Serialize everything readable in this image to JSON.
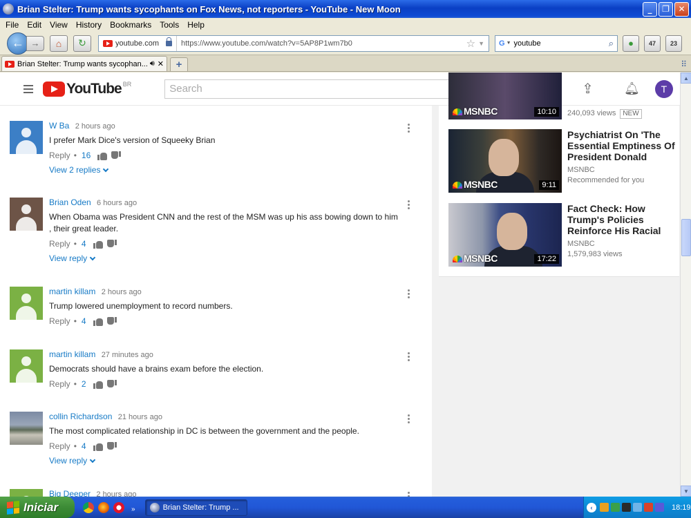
{
  "window": {
    "title": "Brian Stelter: Trump wants sycophants on Fox News, not reporters - YouTube - New Moon",
    "minimize": "_",
    "maximize": "❐",
    "close": "✕"
  },
  "menu": [
    "File",
    "Edit",
    "View",
    "History",
    "Bookmarks",
    "Tools",
    "Help"
  ],
  "nav": {
    "site_label": "youtube.com",
    "url": "https://www.youtube.com/watch?v=5AP8P1wm7b0",
    "search_engine": "G",
    "search_query": "youtube",
    "ext_badges": [
      "47",
      "23"
    ]
  },
  "tab": {
    "title": "Brian Stelter: Trump wants sycophan...",
    "new_tab": "+"
  },
  "youtube": {
    "logo_text": "YouTube",
    "country": "BR",
    "search_placeholder": "Search",
    "avatar_letter": "T"
  },
  "comments": [
    {
      "author": "W Ba",
      "time": "2 hours ago",
      "text": "I prefer Mark Dice's version of Squeeky Brian",
      "reply_label": "Reply",
      "likes": "16",
      "replies_label": "View 2 replies",
      "avatar": "blue"
    },
    {
      "author": "Brian Oden",
      "time": "6 hours ago",
      "text": "When Obama was President CNN and the rest of the MSM was up his ass bowing down to him , their great leader.",
      "reply_label": "Reply",
      "likes": "4",
      "replies_label": "View reply",
      "avatar": "brown"
    },
    {
      "author": "martin killam",
      "time": "2 hours ago",
      "text": "Trump lowered unemployment to record numbers.",
      "reply_label": "Reply",
      "likes": "4",
      "replies_label": "",
      "avatar": "green"
    },
    {
      "author": "martin killam",
      "time": "27 minutes ago",
      "text": "Democrats should have a brains exam before the election.",
      "reply_label": "Reply",
      "likes": "2",
      "replies_label": "",
      "avatar": "green"
    },
    {
      "author": "collin Richardson",
      "time": "21 hours ago",
      "text": "The most complicated relationship in DC is between the government and the people.",
      "reply_label": "Reply",
      "likes": "4",
      "replies_label": "View reply",
      "avatar": "photo"
    },
    {
      "author": "Big Deeper",
      "time": "2 hours ago",
      "text": "",
      "reply_label": "",
      "likes": "",
      "replies_label": "",
      "avatar": "green"
    }
  ],
  "sidebar": {
    "top_partial": {
      "brand": "MSNBC",
      "duration": "10:10",
      "views": "240,093 views",
      "badge": "NEW"
    },
    "videos": [
      {
        "title": "Psychiatrist On 'The Essential Emptiness Of President Donald",
        "channel": "MSNBC",
        "meta": "Recommended for you",
        "duration": "9:11",
        "brand": "MSNBC"
      },
      {
        "title": "Fact Check: How Trump's Policies Reinforce His Racial",
        "channel": "MSNBC",
        "meta": "1,579,983 views",
        "duration": "17:22",
        "brand": "MSNBC"
      }
    ]
  },
  "taskbar": {
    "start_label": "Iniciar",
    "task_title": "Brian Stelter: Trump ...",
    "more": "»",
    "clock": "18:19"
  },
  "colors": {
    "link_blue": "#167ac6",
    "youtube_red": "#e62117",
    "xp_title_blue": "#0a3fc4",
    "avatar_purple": "#5c3ca8"
  }
}
